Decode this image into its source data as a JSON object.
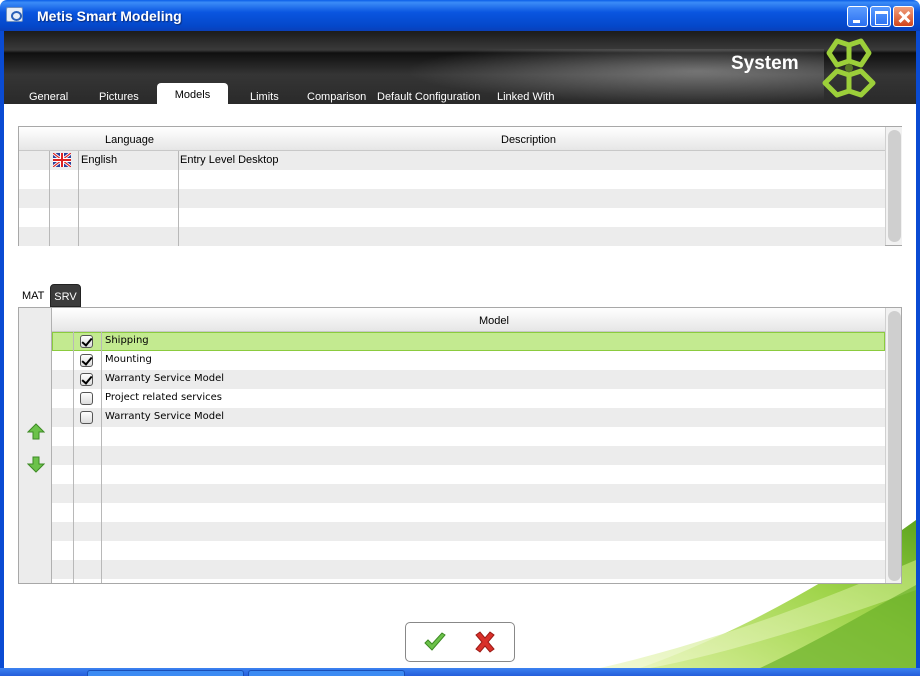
{
  "window": {
    "title": "Metis Smart Modeling"
  },
  "header": {
    "section_title": "System",
    "tabs": [
      {
        "label": "General"
      },
      {
        "label": "Pictures"
      },
      {
        "label": "Models",
        "active": true
      },
      {
        "label": "Limits"
      },
      {
        "label": "Comparison"
      },
      {
        "label": "Default Configuration"
      },
      {
        "label": "Linked With"
      }
    ]
  },
  "language_table": {
    "columns": {
      "language": "Language",
      "description": "Description"
    },
    "rows": [
      {
        "flag_icon": "uk-flag-icon",
        "language": "English",
        "description": "Entry Level Desktop"
      }
    ]
  },
  "sub_tabs": [
    {
      "label": "MAT"
    },
    {
      "label": "SRV",
      "active": true
    }
  ],
  "model_grid": {
    "column": "Model",
    "rows": [
      {
        "checked": true,
        "label": "Shipping",
        "selected": true
      },
      {
        "checked": true,
        "label": "Mounting"
      },
      {
        "checked": true,
        "label": "Warranty Service Model"
      },
      {
        "checked": false,
        "label": "Project related services"
      },
      {
        "checked": false,
        "label": "Warranty Service Model"
      }
    ],
    "move_icons": [
      "arrow-up-icon",
      "arrow-down-icon"
    ]
  },
  "actions": {
    "ok_icon": "checkmark-icon",
    "cancel_icon": "cross-icon"
  },
  "colors": {
    "title_bar": "#0a55e0",
    "header": "#2a2a2a",
    "selected_row": "#c3ea90",
    "accent_green": "#7ab82a",
    "cancel_red": "#d9302a"
  }
}
